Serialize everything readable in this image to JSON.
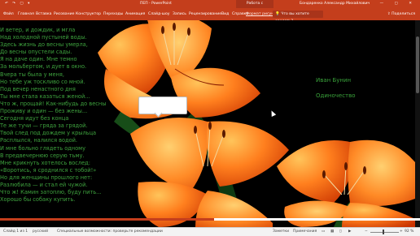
{
  "titlebar": {
    "quick_access": "↶ ↷ ▢ ▾",
    "document": "ПЕП - PowerPoint",
    "context_tab": "Работа с рисунками",
    "user": "Бондаренко Александр Михайлович",
    "window_controls": "— ▢ ✕"
  },
  "ribbon": {
    "tabs": [
      "Файл",
      "Главная",
      "Вставка",
      "Рисование",
      "Конструктор",
      "Переходы",
      "Анимация",
      "Слайд-шоу",
      "Запись",
      "Рецензирование",
      "Вид",
      "Справка",
      "Формат рисунка"
    ],
    "active_tab_index": 12,
    "search_placeholder": "Что вы хотите сделать?",
    "share_label": "Поделиться"
  },
  "slide": {
    "poem_lines": [
      "И ветер, и дождик, и мгла",
      "Над холодной пустыней воды.",
      "Здесь жизнь до весны умерла,",
      "До весны опустели сады.",
      "Я на даче один. Мне темно",
      "За мольбертом, и дует в окно.",
      "Вчера ты была у меня,",
      "Но тебе уж тоскливо со мной.",
      "Под вечер ненастного дня",
      "Ты мне стала казаться женой...",
      "Что ж, прощай! Как-нибудь до весны",
      "Проживу и один — без жены...",
      "Сегодня идут без конца",
      "Те же тучи — гряда за грядой.",
      "Твой след под дождем у крыльца",
      "Расплылся, налился водой.",
      "И мне больно глядеть одному",
      "В предвечернюю серую тьму.",
      "Мне крикнуть хотелось вослед:",
      "«Воротись, я сроднился с тобой!»",
      "Но для женщины прошлого нет:",
      "Разлюбила — и стал ей чужой.",
      "Что ж! Камин затоплю, буду пить...",
      "Хорошо бы собаку купить."
    ],
    "author": "Иван Бунин",
    "title": "Одиночество"
  },
  "colors": {
    "accent": "#c43e1c",
    "poem_text": "#3ea23e",
    "petal_light": "#ffb347",
    "petal_mid": "#ff7a1a",
    "petal_dark": "#d83a00",
    "leaf": "#0f3a12"
  },
  "playback_progress": 0.51,
  "statusbar": {
    "slide_info": "Слайд 1 из 1",
    "language": "русский",
    "accessibility": "Специальные возможности: проверьте рекомендации",
    "notes": "Заметки",
    "comments": "Примечания",
    "zoom": "92 %"
  }
}
